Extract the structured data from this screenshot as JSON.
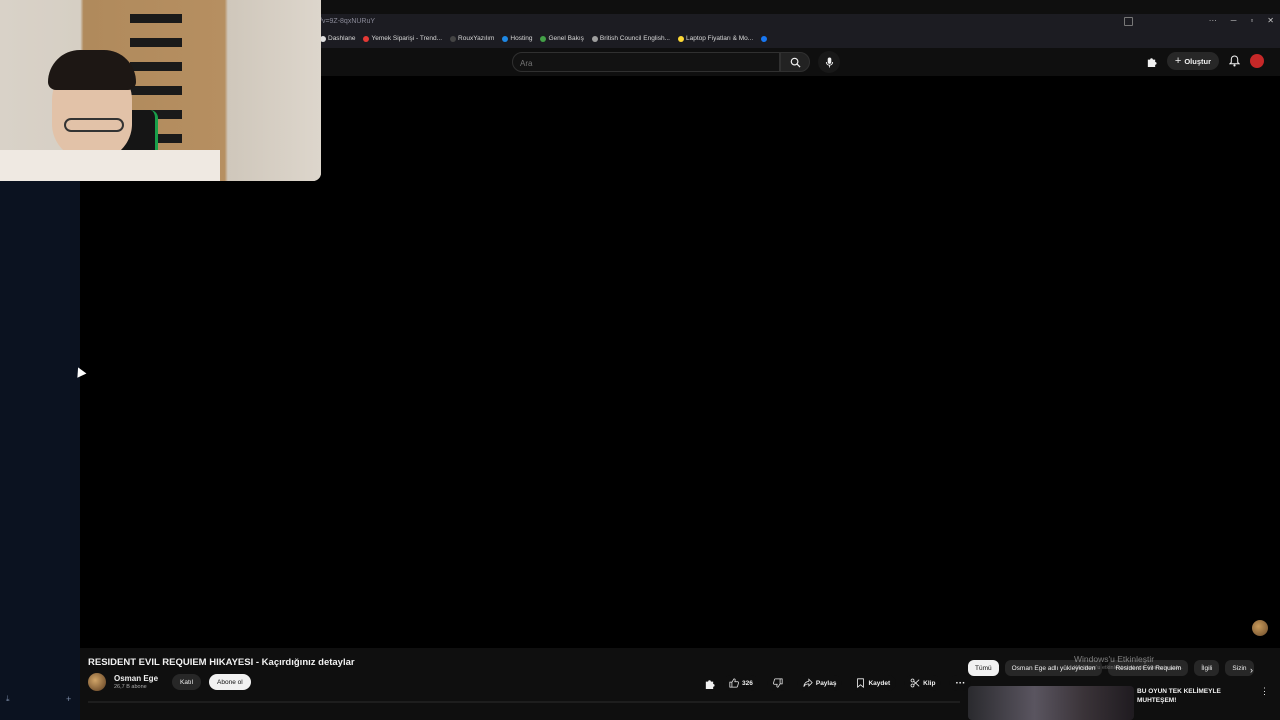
{
  "browser": {
    "url": "/v=9Z-8qxNURuY",
    "window_controls": [
      "···",
      "─",
      "▫",
      "✕"
    ],
    "bookmarks": [
      {
        "label": "Dashlane",
        "color": "#e0e0e0"
      },
      {
        "label": "Yemek Siparişi - Trend...",
        "color": "#e53935"
      },
      {
        "label": "RouxYazılım",
        "color": "#444"
      },
      {
        "label": "Hosting",
        "color": "#1e88e5"
      },
      {
        "label": "Genel Bakış",
        "color": "#43a047"
      },
      {
        "label": "British Council English...",
        "color": "#9e9e9e"
      },
      {
        "label": "Laptop Fiyatları & Mo...",
        "color": "#fdd835"
      },
      {
        "label": "",
        "color": "#1877f2"
      }
    ]
  },
  "topbar": {
    "search_placeholder": "Ara",
    "create_label": "Oluştur"
  },
  "video": {
    "title": "RESIDENT EVIL REQUIEM HIKAYESI - Kaçırdığınız detaylar",
    "channel_name": "Osman Ege",
    "subscribers": "26,7 B abone",
    "join_label": "Katıl",
    "subscribe_label": "Abone ol",
    "likes": "326",
    "share_label": "Paylaş",
    "save_label": "Kaydet",
    "clip_label": "Klip"
  },
  "sidebar_right": {
    "chips": [
      "Tümü",
      "Osman Ege adlı yükleyiciden",
      "Resident Evil Requiem",
      "İlgili",
      "Sizin"
    ],
    "watermark_title": "Windows'u Etkinleştir",
    "watermark_sub": "Windows'u etkinleştirmek için Ayarlar'a gidin.",
    "recommended": [
      {
        "title": "BU OYUN TEK KELİMEYLE MUHTEŞEM!"
      }
    ]
  }
}
